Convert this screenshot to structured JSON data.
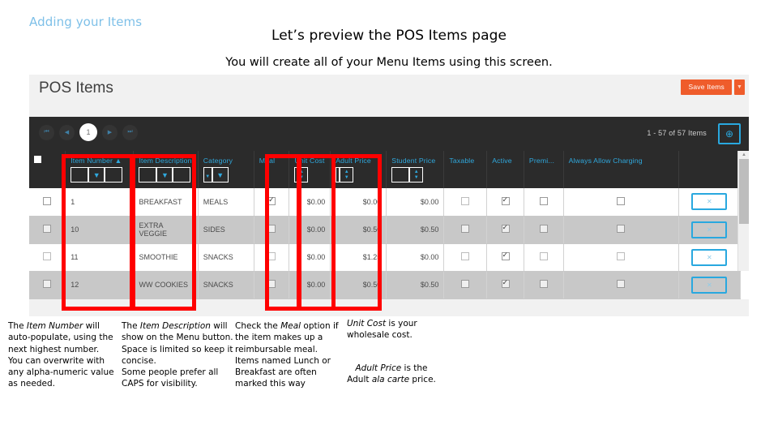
{
  "slide": {
    "kicker": "Adding your Items",
    "title": "Let’s preview the POS Items page",
    "subtitle": "You will create all of your Menu Items using this screen.",
    "accent_blue": "#7ec0e8",
    "highlight_red": "#ff0000"
  },
  "app": {
    "title": "POS Items",
    "save_label": "Save Items",
    "save_caret": "▼",
    "accent_orange": "#ef5c2b",
    "accent_cyan": "#29a8df",
    "toolbar": {
      "first_icon": "⏮",
      "prev_icon": "◀",
      "current_page": "1",
      "next_icon": "▶",
      "last_icon": "⏭",
      "items_count": "1 - 57 of 57 Items",
      "add_icon": "⊕"
    },
    "columns": [
      {
        "label": "",
        "type": "select-all"
      },
      {
        "label": "Item Number ▲",
        "filter": "text-funnel"
      },
      {
        "label": "Item Description",
        "filter": "text-funnel"
      },
      {
        "label": "Category",
        "filter": "caret-funnel"
      },
      {
        "label": "Meal",
        "filter": "none"
      },
      {
        "label": "Unit Cost",
        "filter": "spinner"
      },
      {
        "label": "Adult Price",
        "filter": "text-spinner"
      },
      {
        "label": "Student Price",
        "filter": "text-spinner"
      },
      {
        "label": "Taxable",
        "filter": "none"
      },
      {
        "label": "Active",
        "filter": "none"
      },
      {
        "label": "Premi...",
        "filter": "none"
      },
      {
        "label": "Always Allow Charging",
        "filter": "none"
      },
      {
        "label": "",
        "type": "actions"
      }
    ],
    "rows": [
      {
        "selected": false,
        "item_number": "1",
        "description": "BREAKFAST",
        "category": "MEALS",
        "meal": true,
        "unit_cost": "$0.00",
        "adult_price": "$0.00",
        "student_price": "$0.00",
        "taxable": false,
        "active": true,
        "premium": false,
        "always_allow_charging": false,
        "delete_label": "✕"
      },
      {
        "selected": false,
        "item_number": "10",
        "description": "EXTRA VEGGIE",
        "category": "SIDES",
        "meal": false,
        "unit_cost": "$0.00",
        "adult_price": "$0.50",
        "student_price": "$0.50",
        "taxable": false,
        "active": true,
        "premium": false,
        "always_allow_charging": false,
        "delete_label": "✕"
      },
      {
        "selected": false,
        "item_number": "11",
        "description": "SMOOTHIE",
        "category": "SNACKS",
        "meal": false,
        "unit_cost": "$0.00",
        "adult_price": "$1.25",
        "student_price": "$0.00",
        "taxable": false,
        "active": true,
        "premium": false,
        "always_allow_charging": false,
        "delete_label": "✕"
      },
      {
        "selected": false,
        "item_number": "12",
        "description": "WW COOKIES",
        "category": "SNACKS",
        "meal": false,
        "unit_cost": "$0.00",
        "adult_price": "$0.50",
        "student_price": "$0.50",
        "taxable": false,
        "active": true,
        "premium": false,
        "always_allow_charging": false,
        "delete_label": "✕"
      }
    ]
  },
  "notes": {
    "item_number": {
      "l1_pre": "The ",
      "l1_em": "Item Number",
      "l1_post": " will auto-populate, using the next highest number.",
      "l2": "You can overwrite with any alpha-numeric value as needed."
    },
    "item_description": {
      "l1_pre": "The ",
      "l1_em": "Item Description",
      "l1_post": " will show on the Menu button. Space is limited so keep it concise.",
      "l2": "Some people prefer all CAPS for visibility."
    },
    "meal": {
      "l1_pre": "Check the ",
      "l1_em": "Meal",
      "l1_post": " option if the item makes up a reimbursable meal.",
      "l2": "Items named Lunch or Breakfast are often marked this way"
    },
    "unit_cost": {
      "em": "Unit Cost",
      "post": " is your wholesale cost."
    },
    "adult_price": {
      "em": "Adult Price",
      "mid": " is the Adult ",
      "em2": "ala carte",
      "post": " price."
    }
  }
}
